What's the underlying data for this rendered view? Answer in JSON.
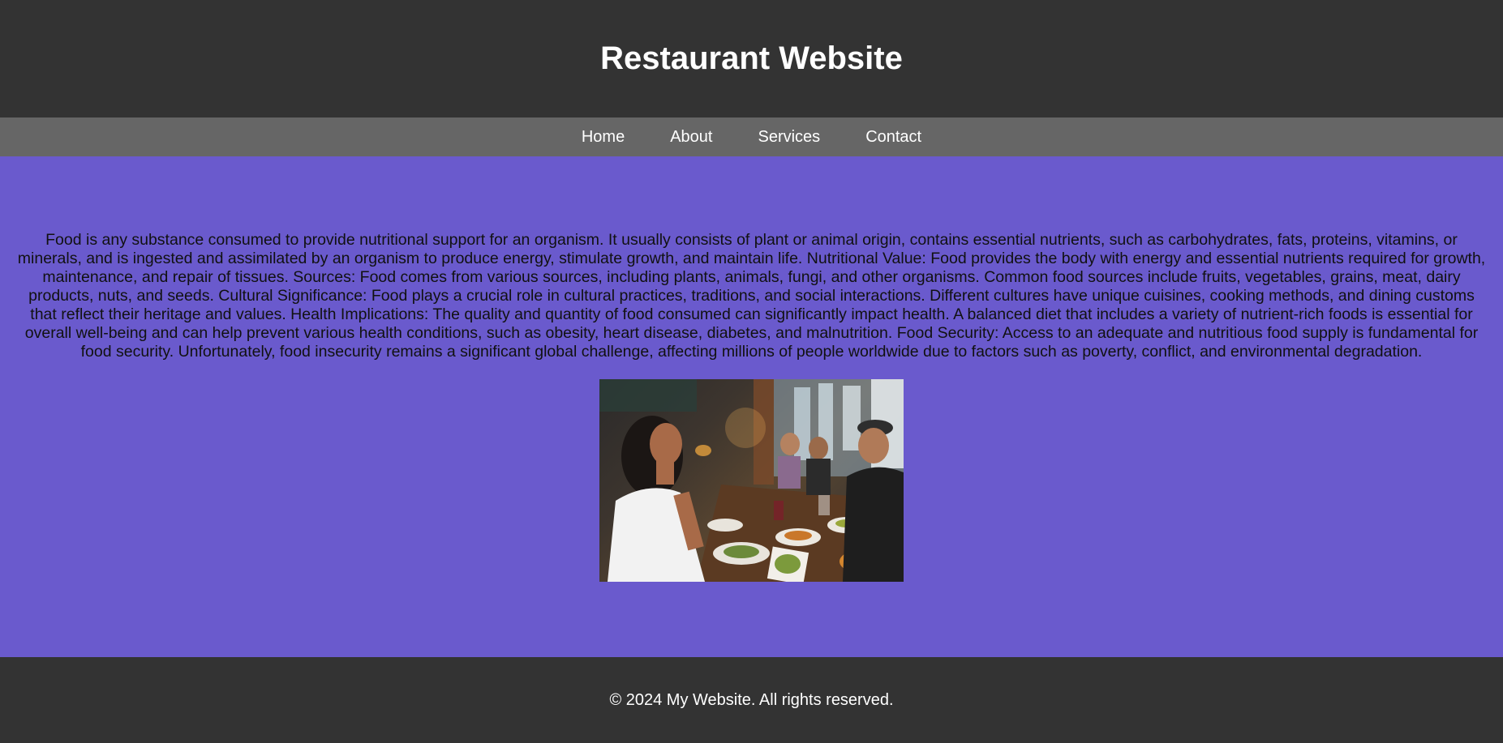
{
  "header": {
    "title": "Restaurant Website"
  },
  "nav": {
    "items": [
      {
        "label": "Home"
      },
      {
        "label": "About"
      },
      {
        "label": "Services"
      },
      {
        "label": "Contact"
      }
    ]
  },
  "main": {
    "paragraph": "Food is any substance consumed to provide nutritional support for an organism. It usually consists of plant or animal origin, contains essential nutrients, such as carbohydrates, fats, proteins, vitamins, or minerals, and is ingested and assimilated by an organism to produce energy, stimulate growth, and maintain life. Nutritional Value: Food provides the body with energy and essential nutrients required for growth, maintenance, and repair of tissues. Sources: Food comes from various sources, including plants, animals, fungi, and other organisms. Common food sources include fruits, vegetables, grains, meat, dairy products, nuts, and seeds. Cultural Significance: Food plays a crucial role in cultural practices, traditions, and social interactions. Different cultures have unique cuisines, cooking methods, and dining customs that reflect their heritage and values. Health Implications: The quality and quantity of food consumed can significantly impact health. A balanced diet that includes a variety of nutrient-rich foods is essential for overall well-being and can help prevent various health conditions, such as obesity, heart disease, diabetes, and malnutrition. Food Security: Access to an adequate and nutritious food supply is fundamental for food security. Unfortunately, food insecurity remains a significant global challenge, affecting millions of people worldwide due to factors such as poverty, conflict, and environmental degradation.",
    "image_icon": "restaurant-dining-photo"
  },
  "footer": {
    "copyright": "© 2024 My Website. All rights reserved."
  },
  "colors": {
    "header_bg": "#333333",
    "nav_bg": "#666666",
    "main_bg": "#6a5acd",
    "footer_bg": "#333333",
    "text_light": "#ffffff"
  }
}
